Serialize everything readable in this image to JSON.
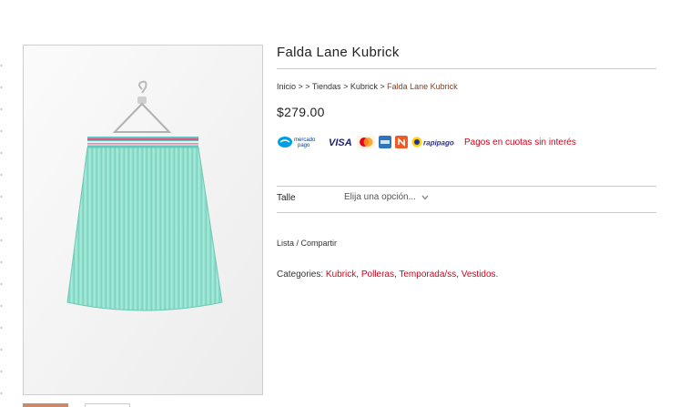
{
  "product": {
    "title": "Falda Lane Kubrick",
    "price": "$279.00"
  },
  "breadcrumb": {
    "home": "Inicio",
    "sep1": " > > ",
    "shops": "Tiendas",
    "sep2": " > ",
    "brand": "Kubrick",
    "sep3": " > ",
    "current": "Falda Lane Kubrick"
  },
  "payments": {
    "methods": [
      "mercado-pago",
      "visa",
      "mastercard",
      "american-express",
      "naranja",
      "rapipago"
    ],
    "mercado_line1": "mercado",
    "mercado_line2": "pago",
    "visa": "VISA",
    "rapipago": "rapipago",
    "note": "Pagos en cuotas sin interés"
  },
  "variation": {
    "label": "Talle",
    "placeholder": "Elija una opción..."
  },
  "share": "Lista / Compartir",
  "categories": {
    "label": "Categories:",
    "items": [
      "Kubrick",
      "Polleras",
      "Temporada/ss",
      "Vestidos."
    ]
  },
  "colors": {
    "accent": "#d0021b",
    "breadcrumb_current": "#8b3d1a",
    "skirt": "#8fe3cf",
    "waistband": [
      "#e8527a",
      "#f2f2f2",
      "#5ec8c0",
      "#f4b6c8",
      "#8fd6cf"
    ]
  }
}
